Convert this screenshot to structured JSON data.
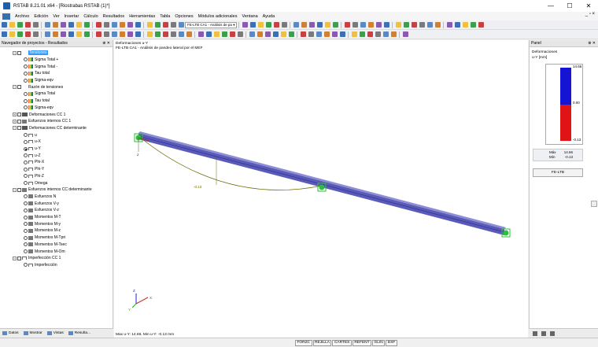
{
  "window": {
    "title": "RSTAB 8.21.01 x64 - [Riostrabas RSTAB (1)*]",
    "min": "—",
    "max": "☐",
    "close": "✕"
  },
  "menu": [
    "Archivo",
    "Edición",
    "Ver",
    "Insertar",
    "Cálculo",
    "Resultados",
    "Herramientas",
    "Tabla",
    "Opciones",
    "Módulos adicionales",
    "Ventana",
    "Ayuda"
  ],
  "mdi_controls": "_ ▫ ×",
  "toolbar": {
    "combo_case": "FE-LTB CA1 - Análisis de pa ▾"
  },
  "navigator": {
    "header": "Navegador de proyectos - Resultados",
    "header_ctrl": "⊕ ✕",
    "items": [
      {
        "label": "Tensiones",
        "depth": 1,
        "type": "group",
        "expander": "−",
        "selected": true
      },
      {
        "label": "Sigma Total +",
        "depth": 2,
        "type": "sig"
      },
      {
        "label": "Sigma Total -",
        "depth": 2,
        "type": "sig"
      },
      {
        "label": "Tau total",
        "depth": 2,
        "type": "sig"
      },
      {
        "label": "Sigma-eqv",
        "depth": 2,
        "type": "sig"
      },
      {
        "label": "Razón de tensiones",
        "depth": 1,
        "type": "group",
        "expander": "−"
      },
      {
        "label": "Sigma Total",
        "depth": 2,
        "type": "sig"
      },
      {
        "label": "Tau total",
        "depth": 2,
        "type": "sig"
      },
      {
        "label": "Sigma-eqv",
        "depth": 2,
        "type": "sig"
      },
      {
        "label": "Deformaciones CC 1",
        "depth": 1,
        "type": "chart",
        "expander": "+"
      },
      {
        "label": "Esfuerzos internos CC 1",
        "depth": 1,
        "type": "frc",
        "expander": "+"
      },
      {
        "label": "Deformaciones CC determinante",
        "depth": 1,
        "type": "chart",
        "expander": "−"
      },
      {
        "label": "u",
        "depth": 2,
        "type": "def"
      },
      {
        "label": "u-X",
        "depth": 2,
        "type": "def"
      },
      {
        "label": "u-Y",
        "depth": 2,
        "type": "def",
        "checked": true
      },
      {
        "label": "u-Z",
        "depth": 2,
        "type": "def"
      },
      {
        "label": "Phi-X",
        "depth": 2,
        "type": "def"
      },
      {
        "label": "Phi-Y",
        "depth": 2,
        "type": "def"
      },
      {
        "label": "Phi-Z",
        "depth": 2,
        "type": "def"
      },
      {
        "label": "Omega",
        "depth": 2,
        "type": "def"
      },
      {
        "label": "Esfuerzos internos CC determinante",
        "depth": 1,
        "type": "frc",
        "expander": "−"
      },
      {
        "label": "Esfuerzos N",
        "depth": 2,
        "type": "frc"
      },
      {
        "label": "Esfuerzos V-y",
        "depth": 2,
        "type": "frc"
      },
      {
        "label": "Esfuerzos V-z",
        "depth": 2,
        "type": "frc"
      },
      {
        "label": "Momentos M-T",
        "depth": 2,
        "type": "frc"
      },
      {
        "label": "Momentos M-y",
        "depth": 2,
        "type": "frc"
      },
      {
        "label": "Momentos M-z",
        "depth": 2,
        "type": "frc"
      },
      {
        "label": "Momentos M-Tpri",
        "depth": 2,
        "type": "frc"
      },
      {
        "label": "Momentos M-Tsec",
        "depth": 2,
        "type": "frc"
      },
      {
        "label": "Momentos M-Om",
        "depth": 2,
        "type": "frc"
      },
      {
        "label": "Imperfección CC 1",
        "depth": 1,
        "type": "def",
        "expander": "−"
      },
      {
        "label": "Imperfección",
        "depth": 2,
        "type": "def"
      }
    ],
    "tabs": [
      "Datos",
      "Mostrar",
      "Vistas",
      "Resulta..."
    ]
  },
  "viewport": {
    "title_line1": "Deformaciones u-Y",
    "title_line2": "FE-LTB CA1 - Análisis de pandeo lateral por el MEF",
    "deflection_label": "-0.13",
    "status_text": "Max u-Y: 14.66, Min u-Y: -0.13 mm",
    "axis_z": "Z",
    "axis_x": "X",
    "axis_y": "Y"
  },
  "panel": {
    "header": "Panel",
    "header_ctrl": "⊕ ✕",
    "title": "Deformaciones",
    "unit": "u-Y [mm]",
    "legend_max": "14.66",
    "legend_mid": "0.00",
    "legend_min": "-0.13",
    "max_label": "Máx",
    "max_value": "14.66",
    "min_label": "Mín",
    "min_value": "-0.13",
    "button": "FE-LTB",
    "colors": {
      "positive": "#1414d2",
      "negative": "#e01414"
    }
  },
  "statusbar": {
    "buttons": [
      "FORZC",
      "REJILLA",
      "CARTES",
      "REFENT",
      "GLIN",
      "DXF"
    ]
  }
}
